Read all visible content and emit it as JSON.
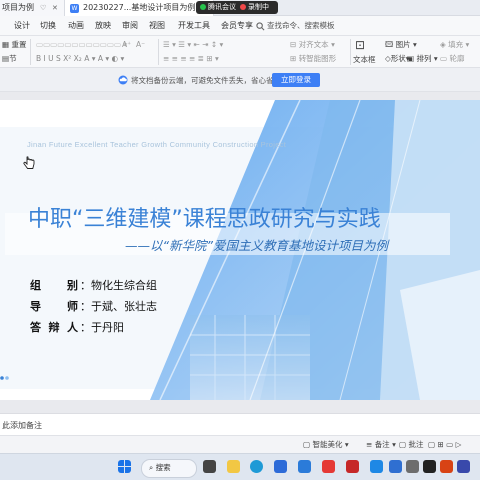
{
  "tabs": [
    {
      "label": "项目为例"
    },
    {
      "label": "20230227...基地设计项目为例"
    }
  ],
  "meeting": {
    "app": "腾讯会议",
    "status": "录制中"
  },
  "menu": {
    "items": [
      "设计",
      "切换",
      "动画",
      "放映",
      "审阅",
      "视图",
      "开发工具",
      "会员专享"
    ],
    "search_placeholder": "查找命令、搜索模板"
  },
  "ribbon": {
    "reset": "重置",
    "section": "节",
    "font_size_up": "A⁺",
    "font_size_down": "A⁻",
    "align_text": "对齐文本",
    "text_box": "文本框",
    "shapes": "形状",
    "arrange": "排列",
    "picture": "图片",
    "fill": "填充",
    "smart_art": "转智能图形",
    "outline": "轮廓"
  },
  "banner": {
    "text": "将文档备份云端，可避免文件丢失，省心省事",
    "button": "立即登录"
  },
  "slide": {
    "subtitle_en": "Jinan Future Excellent Teacher Growth Community Construction Project",
    "title": "中职“三维建模”课程思政研究与实践",
    "subtitle": "——以“新华院”爱国主义教育基地设计项目为例",
    "info": [
      {
        "label": "组    别",
        "value": "物化生综合组"
      },
      {
        "label": "导    师",
        "value": "于斌、张壮志"
      },
      {
        "label": "答辩人",
        "value": "于丹阳"
      }
    ]
  },
  "notes": {
    "placeholder": "此添加备注"
  },
  "statusbar": {
    "smart_beautify": "智能美化",
    "notes": "备注",
    "comments": "批注"
  },
  "taskbar": {
    "search_label": "搜索"
  },
  "colors": {
    "accent": "#3d7ff5",
    "title_blue": "#3a82d6",
    "subtitle_blue": "#2f6fb7"
  }
}
